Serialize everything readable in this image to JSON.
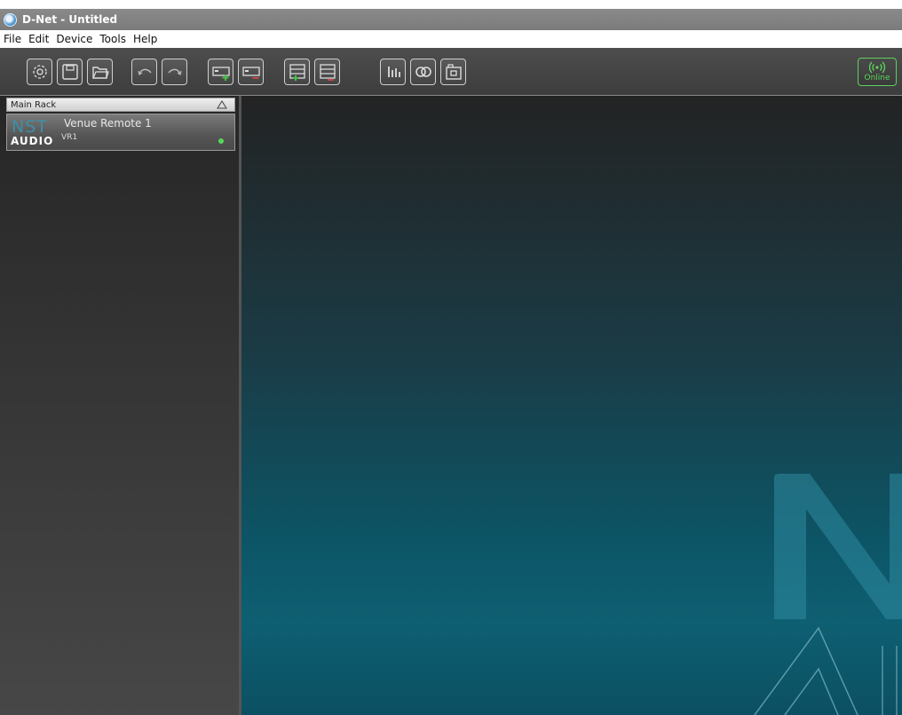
{
  "window": {
    "title": "D-Net - Untitled"
  },
  "menu": [
    "File",
    "Edit",
    "Device",
    "Tools",
    "Help"
  ],
  "toolbar": {
    "buttons": [
      {
        "name": "settings",
        "icon": "gear-icon"
      },
      {
        "name": "save",
        "icon": "save-icon"
      },
      {
        "name": "open",
        "icon": "folder-icon"
      },
      {
        "name": "undo",
        "icon": "undo-icon"
      },
      {
        "name": "redo",
        "icon": "redo-icon"
      },
      {
        "name": "add-device",
        "icon": "add-device-icon"
      },
      {
        "name": "remove-device",
        "icon": "remove-device-icon"
      },
      {
        "name": "add-rack",
        "icon": "add-rack-icon"
      },
      {
        "name": "remove-rack",
        "icon": "remove-rack-icon"
      },
      {
        "name": "meters",
        "icon": "meter-icon"
      },
      {
        "name": "link",
        "icon": "link-icon"
      },
      {
        "name": "snapshot",
        "icon": "camera-icon"
      }
    ],
    "online_label": "Online",
    "online_color": "#58d858"
  },
  "sidebar": {
    "rack_title": "Main Rack",
    "devices": [
      {
        "logo_top": "NST",
        "logo_bottom": "AUDIO",
        "name": "Venue Remote 1",
        "id": "VR1",
        "status_color": "#57d957"
      }
    ]
  },
  "colors": {
    "accent": "#3e8fa8",
    "canvas_top": "#232323",
    "canvas_bottom": "#0e5f72"
  }
}
